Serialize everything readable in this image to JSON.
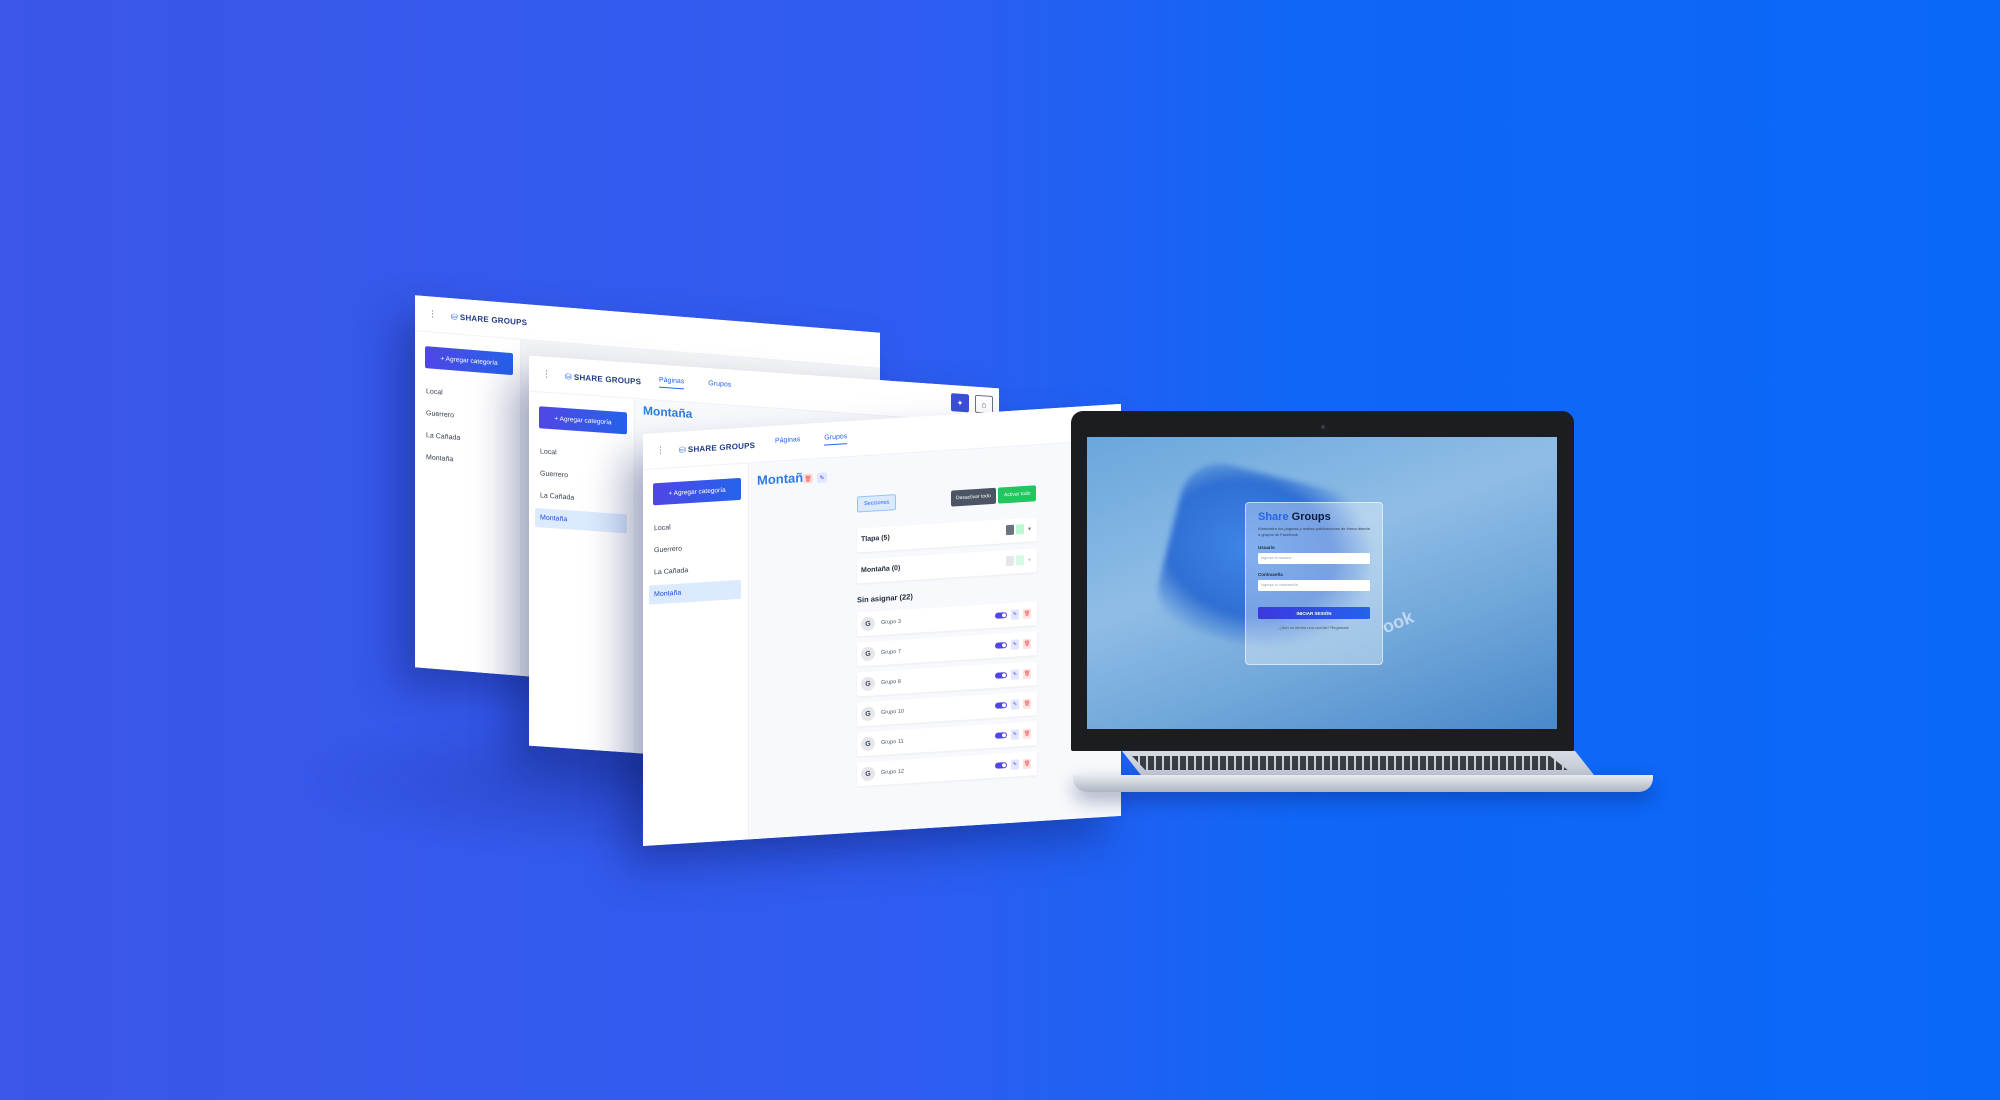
{
  "brand": {
    "icon": "database-icon",
    "text": "SHARE GROUPS"
  },
  "tabs": [
    "Páginas",
    "Grupos"
  ],
  "top_buttons": {
    "primary_icon": "share-icon",
    "secondary_icon": "lock-icon"
  },
  "sidebar": {
    "add_label": "+ Agregar categoría",
    "items": [
      "Local",
      "Guerrero",
      "La Cañada",
      "Montaña"
    ],
    "active_index": 3
  },
  "main": {
    "title": "Montaña",
    "title_badges": [
      "🗑",
      "✎"
    ],
    "controls": {
      "sections": "Secciones",
      "disable_all": "Desactivar todo",
      "activate_all": "Activar todo"
    },
    "sections": [
      {
        "name": "Tlapa (5)"
      },
      {
        "name": "Montaña (0)"
      }
    ],
    "unassigned_label": "Sin asignar (22)",
    "groups": [
      {
        "avatar": "G",
        "name": "Grupo 3"
      },
      {
        "avatar": "G",
        "name": "Grupo 7"
      },
      {
        "avatar": "G",
        "name": "Grupo 8"
      },
      {
        "avatar": "G",
        "name": "Grupo 10"
      },
      {
        "avatar": "G",
        "name": "Grupo 11"
      },
      {
        "avatar": "G",
        "name": "Grupo 12"
      }
    ]
  },
  "login": {
    "title_accent": "Share",
    "title_rest": " Groups",
    "subtitle": "Administra tus páginas y realiza publicaciones de forma directa a grupos de Facebook",
    "user_label": "Usuario",
    "user_placeholder": "Ingresa tu usuario",
    "password_label": "Contraseña",
    "password_placeholder": "Ingresa tu contraseña",
    "button": "INICIAR SESIÓN",
    "register": "¿Aún no tienes una cuenta? Regístrate",
    "bg_word": "ook"
  },
  "colors": {
    "accent": "#2563eb",
    "background_left": "#3b56e8",
    "background_right": "#0a68f8"
  }
}
